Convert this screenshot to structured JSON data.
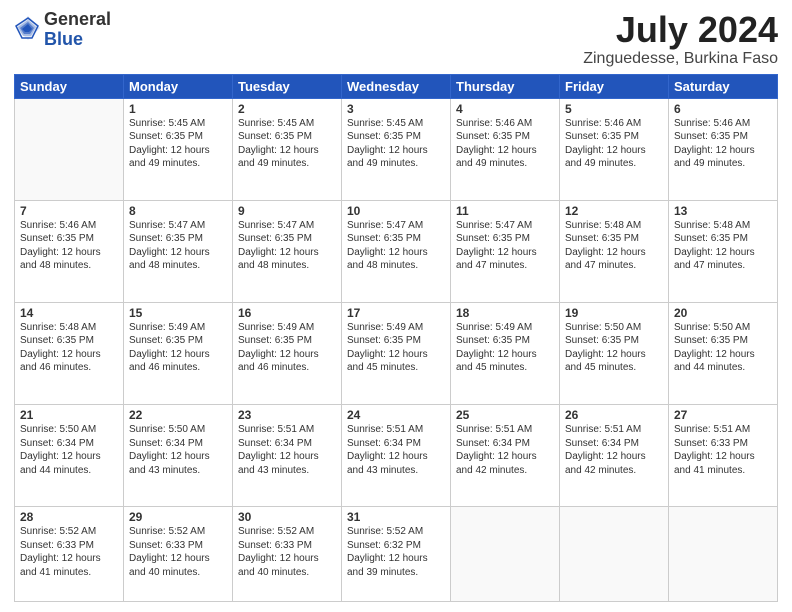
{
  "header": {
    "logo_line1": "General",
    "logo_line2": "Blue",
    "month": "July 2024",
    "location": "Zinguedesse, Burkina Faso"
  },
  "days_of_week": [
    "Sunday",
    "Monday",
    "Tuesday",
    "Wednesday",
    "Thursday",
    "Friday",
    "Saturday"
  ],
  "weeks": [
    [
      {
        "day": "",
        "info": ""
      },
      {
        "day": "1",
        "info": "Sunrise: 5:45 AM\nSunset: 6:35 PM\nDaylight: 12 hours\nand 49 minutes."
      },
      {
        "day": "2",
        "info": "Sunrise: 5:45 AM\nSunset: 6:35 PM\nDaylight: 12 hours\nand 49 minutes."
      },
      {
        "day": "3",
        "info": "Sunrise: 5:45 AM\nSunset: 6:35 PM\nDaylight: 12 hours\nand 49 minutes."
      },
      {
        "day": "4",
        "info": "Sunrise: 5:46 AM\nSunset: 6:35 PM\nDaylight: 12 hours\nand 49 minutes."
      },
      {
        "day": "5",
        "info": "Sunrise: 5:46 AM\nSunset: 6:35 PM\nDaylight: 12 hours\nand 49 minutes."
      },
      {
        "day": "6",
        "info": "Sunrise: 5:46 AM\nSunset: 6:35 PM\nDaylight: 12 hours\nand 49 minutes."
      }
    ],
    [
      {
        "day": "7",
        "info": "Sunrise: 5:46 AM\nSunset: 6:35 PM\nDaylight: 12 hours\nand 48 minutes."
      },
      {
        "day": "8",
        "info": "Sunrise: 5:47 AM\nSunset: 6:35 PM\nDaylight: 12 hours\nand 48 minutes."
      },
      {
        "day": "9",
        "info": "Sunrise: 5:47 AM\nSunset: 6:35 PM\nDaylight: 12 hours\nand 48 minutes."
      },
      {
        "day": "10",
        "info": "Sunrise: 5:47 AM\nSunset: 6:35 PM\nDaylight: 12 hours\nand 48 minutes."
      },
      {
        "day": "11",
        "info": "Sunrise: 5:47 AM\nSunset: 6:35 PM\nDaylight: 12 hours\nand 47 minutes."
      },
      {
        "day": "12",
        "info": "Sunrise: 5:48 AM\nSunset: 6:35 PM\nDaylight: 12 hours\nand 47 minutes."
      },
      {
        "day": "13",
        "info": "Sunrise: 5:48 AM\nSunset: 6:35 PM\nDaylight: 12 hours\nand 47 minutes."
      }
    ],
    [
      {
        "day": "14",
        "info": "Sunrise: 5:48 AM\nSunset: 6:35 PM\nDaylight: 12 hours\nand 46 minutes."
      },
      {
        "day": "15",
        "info": "Sunrise: 5:49 AM\nSunset: 6:35 PM\nDaylight: 12 hours\nand 46 minutes."
      },
      {
        "day": "16",
        "info": "Sunrise: 5:49 AM\nSunset: 6:35 PM\nDaylight: 12 hours\nand 46 minutes."
      },
      {
        "day": "17",
        "info": "Sunrise: 5:49 AM\nSunset: 6:35 PM\nDaylight: 12 hours\nand 45 minutes."
      },
      {
        "day": "18",
        "info": "Sunrise: 5:49 AM\nSunset: 6:35 PM\nDaylight: 12 hours\nand 45 minutes."
      },
      {
        "day": "19",
        "info": "Sunrise: 5:50 AM\nSunset: 6:35 PM\nDaylight: 12 hours\nand 45 minutes."
      },
      {
        "day": "20",
        "info": "Sunrise: 5:50 AM\nSunset: 6:35 PM\nDaylight: 12 hours\nand 44 minutes."
      }
    ],
    [
      {
        "day": "21",
        "info": "Sunrise: 5:50 AM\nSunset: 6:34 PM\nDaylight: 12 hours\nand 44 minutes."
      },
      {
        "day": "22",
        "info": "Sunrise: 5:50 AM\nSunset: 6:34 PM\nDaylight: 12 hours\nand 43 minutes."
      },
      {
        "day": "23",
        "info": "Sunrise: 5:51 AM\nSunset: 6:34 PM\nDaylight: 12 hours\nand 43 minutes."
      },
      {
        "day": "24",
        "info": "Sunrise: 5:51 AM\nSunset: 6:34 PM\nDaylight: 12 hours\nand 43 minutes."
      },
      {
        "day": "25",
        "info": "Sunrise: 5:51 AM\nSunset: 6:34 PM\nDaylight: 12 hours\nand 42 minutes."
      },
      {
        "day": "26",
        "info": "Sunrise: 5:51 AM\nSunset: 6:34 PM\nDaylight: 12 hours\nand 42 minutes."
      },
      {
        "day": "27",
        "info": "Sunrise: 5:51 AM\nSunset: 6:33 PM\nDaylight: 12 hours\nand 41 minutes."
      }
    ],
    [
      {
        "day": "28",
        "info": "Sunrise: 5:52 AM\nSunset: 6:33 PM\nDaylight: 12 hours\nand 41 minutes."
      },
      {
        "day": "29",
        "info": "Sunrise: 5:52 AM\nSunset: 6:33 PM\nDaylight: 12 hours\nand 40 minutes."
      },
      {
        "day": "30",
        "info": "Sunrise: 5:52 AM\nSunset: 6:33 PM\nDaylight: 12 hours\nand 40 minutes."
      },
      {
        "day": "31",
        "info": "Sunrise: 5:52 AM\nSunset: 6:32 PM\nDaylight: 12 hours\nand 39 minutes."
      },
      {
        "day": "",
        "info": ""
      },
      {
        "day": "",
        "info": ""
      },
      {
        "day": "",
        "info": ""
      }
    ]
  ]
}
